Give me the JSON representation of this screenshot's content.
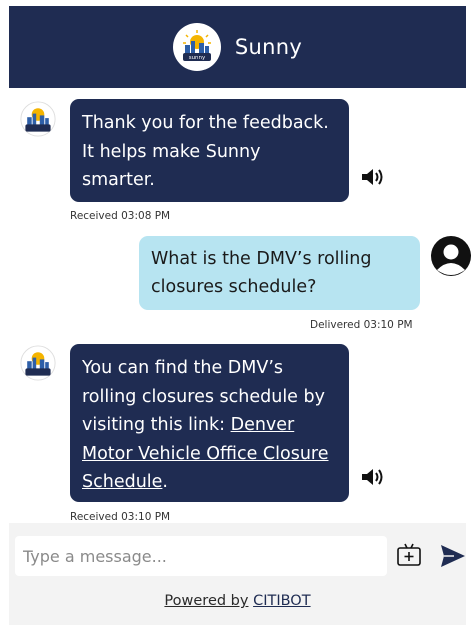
{
  "header": {
    "title": "Sunny",
    "logo_text": "sunny",
    "background": "#1f2c52"
  },
  "messages": [
    {
      "from": "bot",
      "text": "Thank you for the feedback. It helps make Sunny smarter.",
      "meta": "Received 03:08 PM"
    },
    {
      "from": "user",
      "text": "What is the DMV’s rolling closures schedule?",
      "meta": "Delivered 03:10 PM"
    },
    {
      "from": "bot",
      "text_before_link": "You can find the DMV’s rolling closures schedule by visiting this link: ",
      "link_text": "Denver Motor Vehicle Office Closure Schedule",
      "text_after_link": ".",
      "meta": "Received 03:10 PM"
    }
  ],
  "composer": {
    "placeholder": "Type a message...",
    "attach_icon": "attachment-icon",
    "send_icon": "send-icon"
  },
  "footer": {
    "powered_prefix": "Powered by",
    "brand": "CITIBOT"
  },
  "colors": {
    "bot_bubble": "#1f2c52",
    "user_bubble": "#b7e4f1",
    "composer_bg": "#f3f3f3"
  }
}
